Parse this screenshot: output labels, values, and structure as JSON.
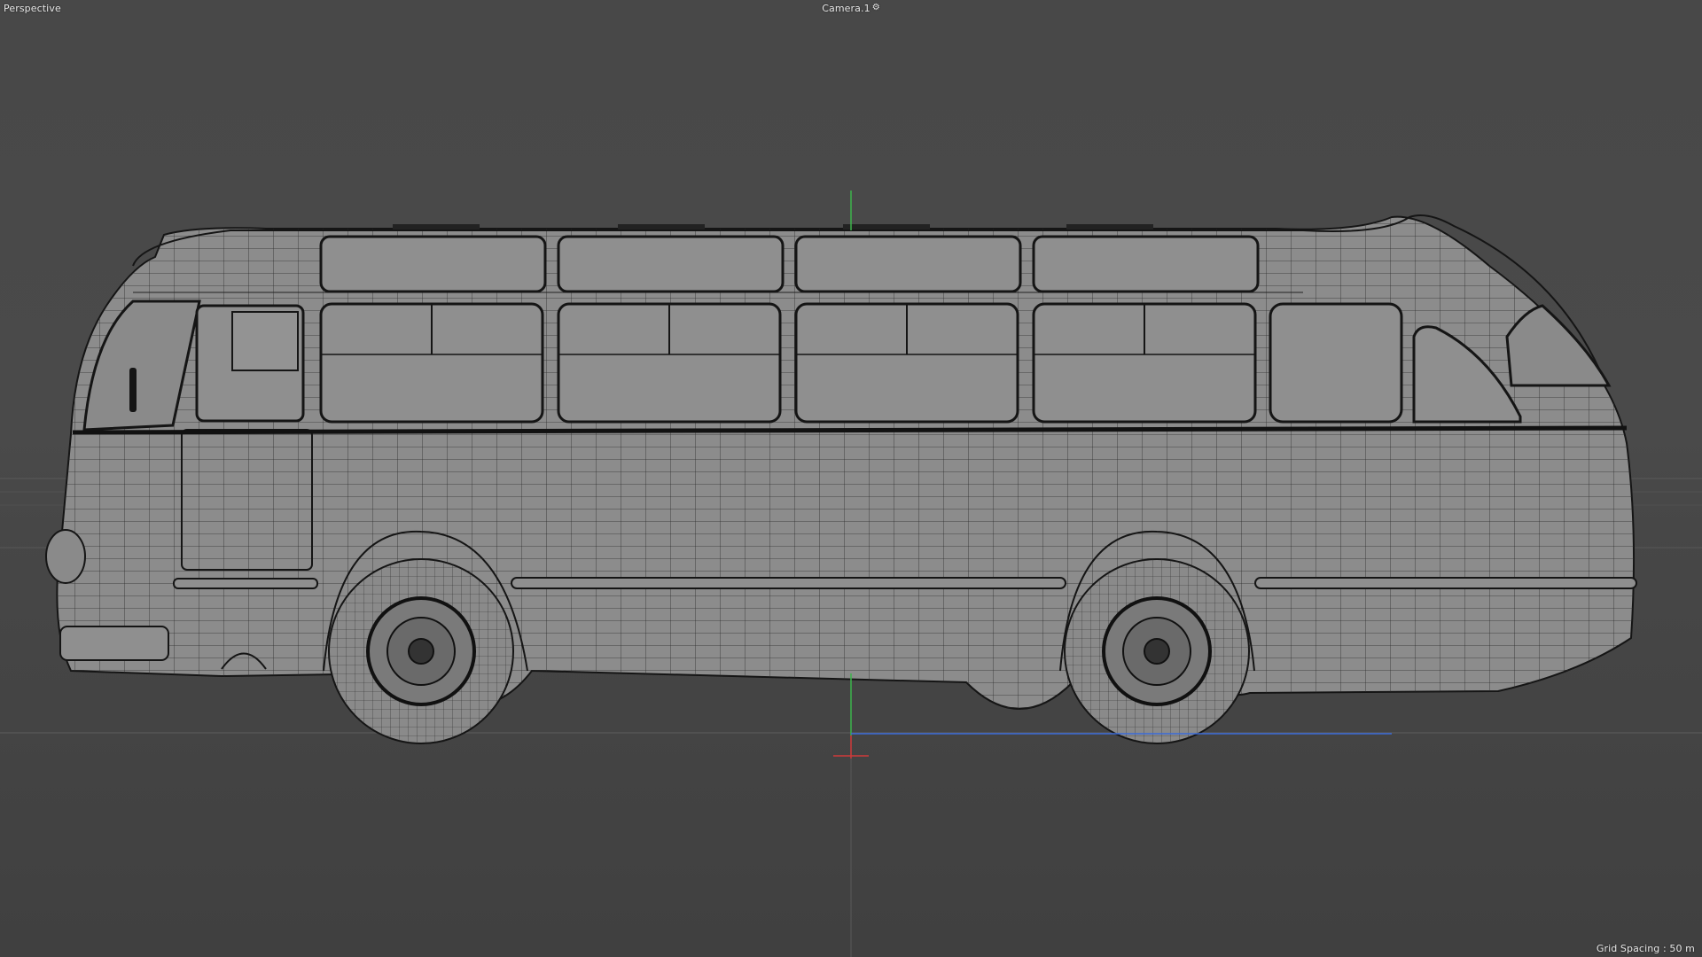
{
  "viewport": {
    "view_name": "Perspective",
    "camera_name": "Camera.1",
    "camera_icon": "camera-icon",
    "grid_spacing": "Grid Spacing : 50 m",
    "background_color": "#4a4a4a"
  },
  "model": {
    "object_type": "vintage bus",
    "display_mode": "wireframe"
  },
  "axes": {
    "y_color": "#3cb44b",
    "x_color": "#d03a3a",
    "z_color": "#3a6ad8"
  }
}
